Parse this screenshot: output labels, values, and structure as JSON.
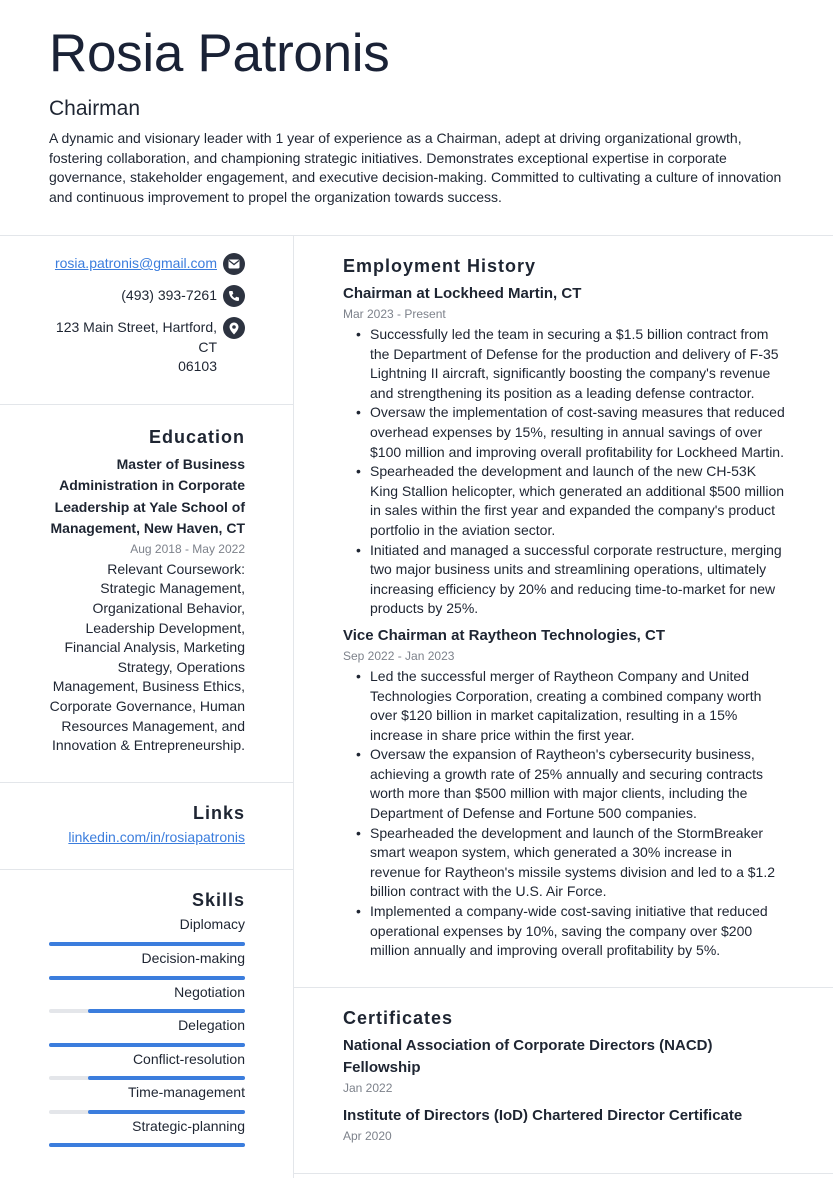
{
  "header": {
    "name": "Rosia Patronis",
    "title": "Chairman",
    "summary": "A dynamic and visionary leader with 1 year of experience as a Chairman, adept at driving organizational growth, fostering collaboration, and championing strategic initiatives. Demonstrates exceptional expertise in corporate governance, stakeholder engagement, and executive decision-making. Committed to cultivating a culture of innovation and continuous improvement to propel the organization towards success."
  },
  "contact": {
    "email": "rosia.patronis@gmail.com",
    "phone": "(493) 393-7261",
    "address_line1": "123 Main Street, Hartford, CT",
    "address_line2": "06103",
    "icons": [
      "envelope-icon",
      "phone-icon",
      "map-pin-icon"
    ]
  },
  "education": {
    "heading": "Education",
    "degree": "Master of Business Administration in Corporate Leadership at Yale School of Management, New Haven, CT",
    "dates": "Aug 2018 - May 2022",
    "coursework": "Relevant Coursework: Strategic Management, Organizational Behavior, Leadership Development, Financial Analysis, Marketing Strategy, Operations Management, Business Ethics, Corporate Governance, Human Resources Management, and Innovation & Entrepreneurship."
  },
  "links": {
    "heading": "Links",
    "items": [
      {
        "label": "linkedin.com/in/rosiapatronis"
      }
    ]
  },
  "skills": {
    "heading": "Skills",
    "accent": "#3b7ddd",
    "items": [
      {
        "name": "Diplomacy",
        "level": 100
      },
      {
        "name": "Decision-making",
        "level": 100
      },
      {
        "name": "Negotiation",
        "level": 80
      },
      {
        "name": "Delegation",
        "level": 100
      },
      {
        "name": "Conflict-resolution",
        "level": 80
      },
      {
        "name": "Time-management",
        "level": 80
      },
      {
        "name": "Strategic-planning",
        "level": 100
      }
    ]
  },
  "employment": {
    "heading": "Employment History",
    "jobs": [
      {
        "title": "Chairman at Lockheed Martin, CT",
        "dates": "Mar 2023 - Present",
        "bullets": [
          "Successfully led the team in securing a $1.5 billion contract from the Department of Defense for the production and delivery of F-35 Lightning II aircraft, significantly boosting the company's revenue and strengthening its position as a leading defense contractor.",
          "Oversaw the implementation of cost-saving measures that reduced overhead expenses by 15%, resulting in annual savings of over $100 million and improving overall profitability for Lockheed Martin.",
          "Spearheaded the development and launch of the new CH-53K King Stallion helicopter, which generated an additional $500 million in sales within the first year and expanded the company's product portfolio in the aviation sector.",
          "Initiated and managed a successful corporate restructure, merging two major business units and streamlining operations, ultimately increasing efficiency by 20% and reducing time-to-market for new products by 25%."
        ]
      },
      {
        "title": "Vice Chairman at Raytheon Technologies, CT",
        "dates": "Sep 2022 - Jan 2023",
        "bullets": [
          "Led the successful merger of Raytheon Company and United Technologies Corporation, creating a combined company worth over $120 billion in market capitalization, resulting in a 15% increase in share price within the first year.",
          "Oversaw the expansion of Raytheon's cybersecurity business, achieving a growth rate of 25% annually and securing contracts worth more than $500 million with major clients, including the Department of Defense and Fortune 500 companies.",
          "Spearheaded the development and launch of the StormBreaker smart weapon system, which generated a 30% increase in revenue for Raytheon's missile systems division and led to a $1.2 billion contract with the U.S. Air Force.",
          "Implemented a company-wide cost-saving initiative that reduced operational expenses by 10%, saving the company over $200 million annually and improving overall profitability by 5%."
        ]
      }
    ]
  },
  "certificates": {
    "heading": "Certificates",
    "items": [
      {
        "title": "National Association of Corporate Directors (NACD) Fellowship",
        "date": "Jan 2022"
      },
      {
        "title": "Institute of Directors (IoD) Chartered Director Certificate",
        "date": "Apr 2020"
      }
    ]
  }
}
